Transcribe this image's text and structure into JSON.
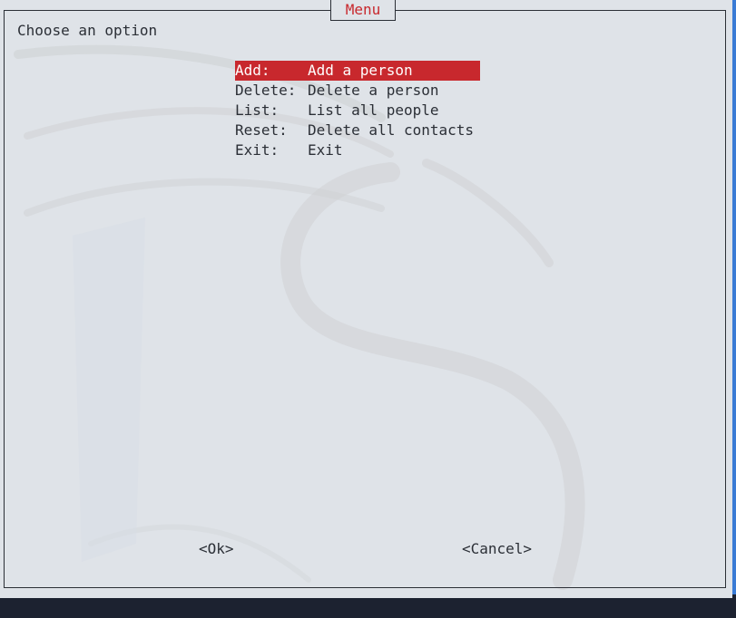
{
  "dialog": {
    "title": "Menu",
    "prompt": "Choose an option",
    "selected_index": 0,
    "items": [
      {
        "key": "Add:",
        "description": "Add a person"
      },
      {
        "key": "Delete:",
        "description": "Delete a person"
      },
      {
        "key": "List:",
        "description": "List all people"
      },
      {
        "key": "Reset:",
        "description": "Delete all contacts"
      },
      {
        "key": "Exit:",
        "description": "Exit"
      }
    ],
    "buttons": {
      "ok": "<Ok>",
      "cancel": "<Cancel>"
    }
  },
  "colors": {
    "highlight": "#c8282d",
    "title": "#c8282d",
    "background": "#dfe3e8",
    "text": "#2b2f36"
  }
}
